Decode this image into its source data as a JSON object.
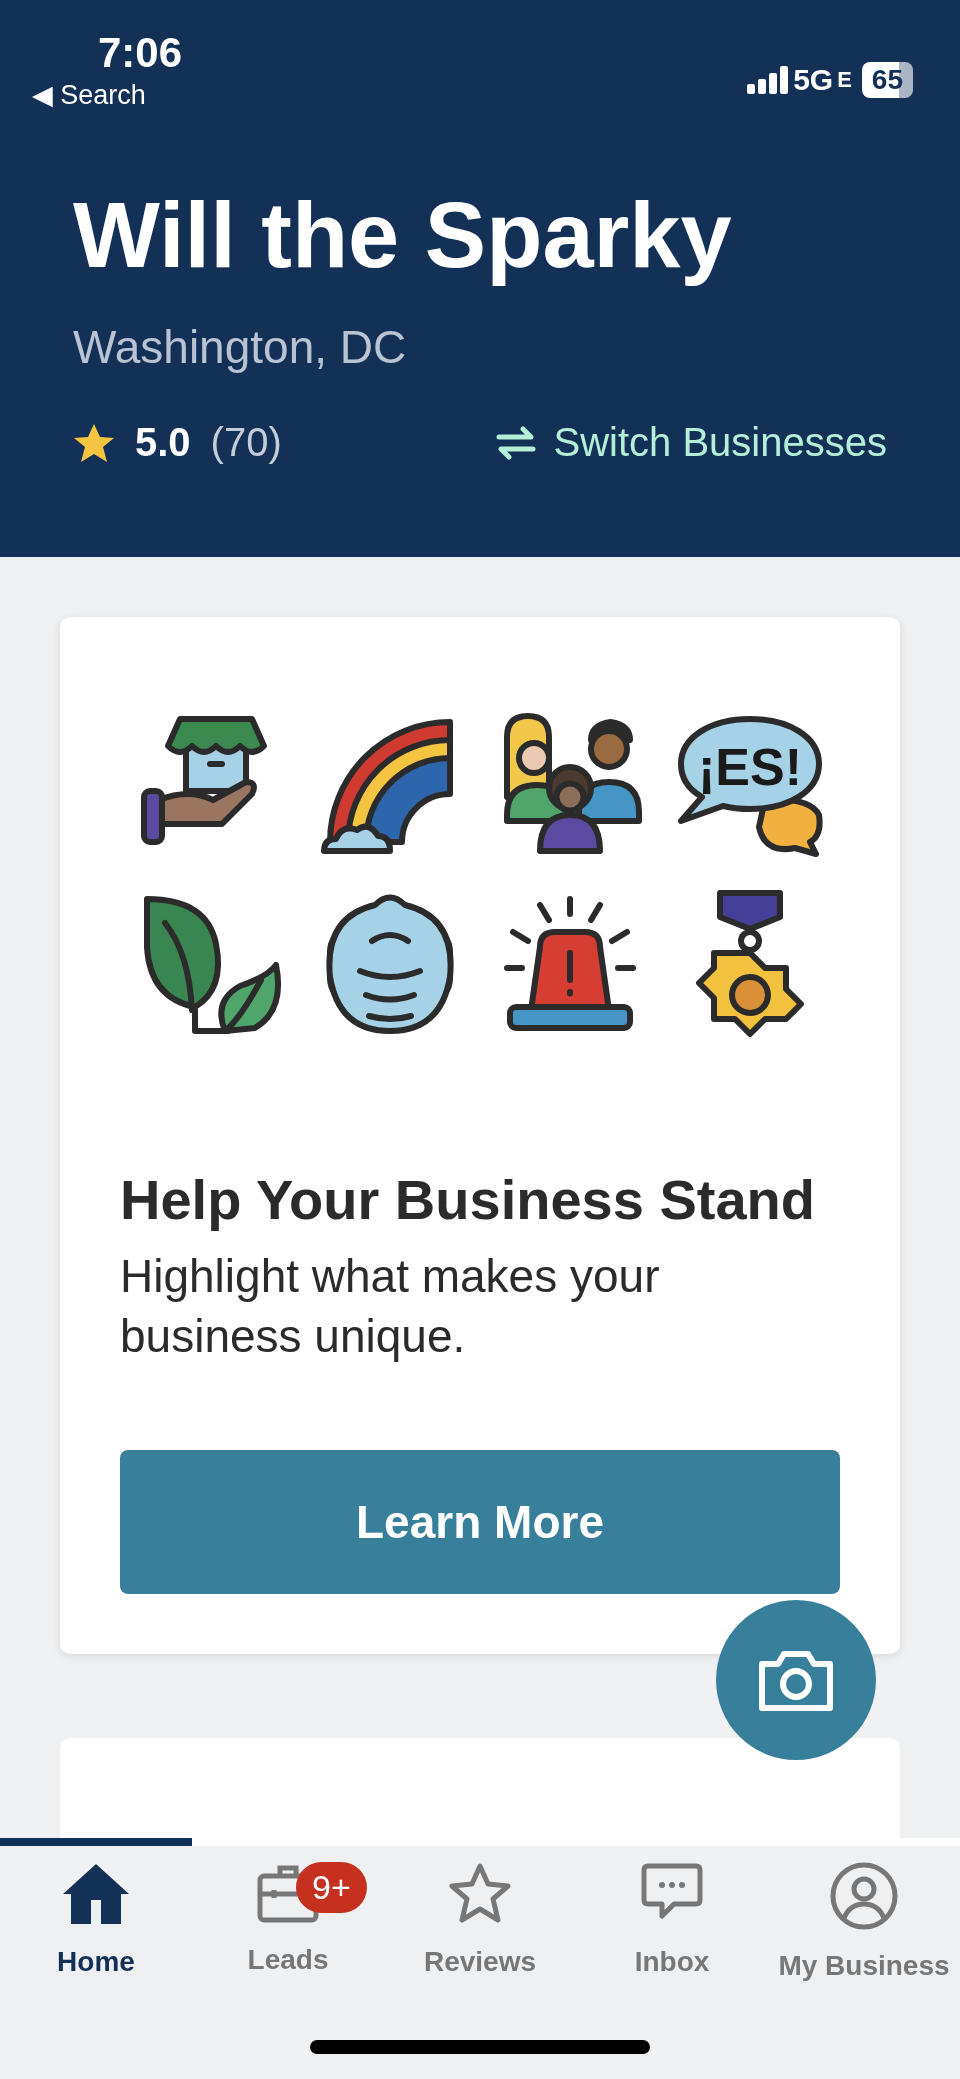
{
  "status_bar": {
    "time": "7:06",
    "back": "◀ Search",
    "network": "5G",
    "network_suffix": "E",
    "battery": "65"
  },
  "business": {
    "name": "Will the Sparky",
    "location": "Washington, DC",
    "rating": "5.0",
    "review_count": "(70)",
    "switch_label": "Switch Businesses"
  },
  "promo_card": {
    "icons": [
      {
        "kind": "shop"
      },
      {
        "kind": "rainbow"
      },
      {
        "kind": "people"
      },
      {
        "kind": "speech",
        "label": "¡ES!"
      },
      {
        "kind": "leaf"
      },
      {
        "kind": "mask"
      },
      {
        "kind": "siren"
      },
      {
        "kind": "medal"
      }
    ],
    "heading": "Help Your Business Stand",
    "body": "Highlight what makes your business unique.",
    "button": "Learn More"
  },
  "tab_bar": {
    "progress": {
      "level": 0.2
    },
    "tabs": [
      {
        "label": "Home",
        "kind": "home",
        "selected": true
      },
      {
        "label": "Leads",
        "kind": "briefcase",
        "selected": false,
        "badge": "9+"
      },
      {
        "label": "Reviews",
        "kind": "star",
        "selected": false
      },
      {
        "label": "Inbox",
        "kind": "chat",
        "selected": false
      },
      {
        "label": "My Business",
        "kind": "user",
        "selected": false
      }
    ]
  }
}
